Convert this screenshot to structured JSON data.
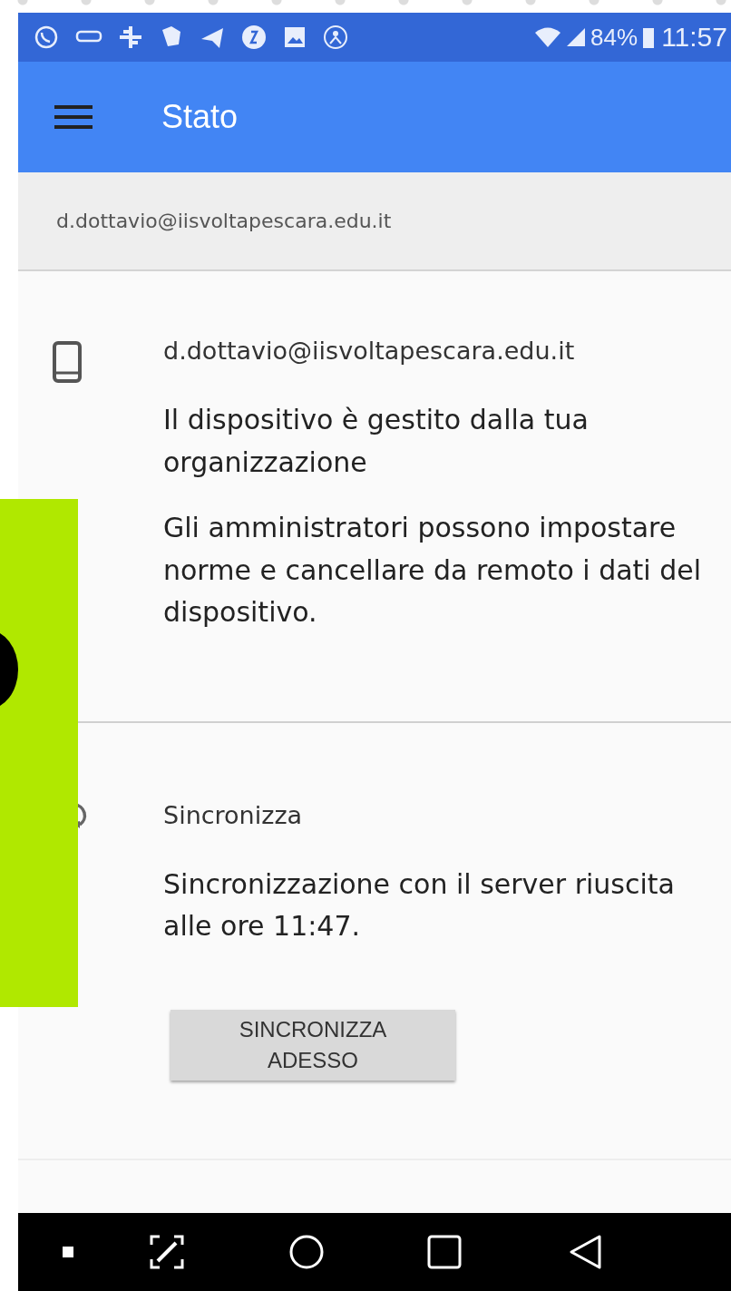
{
  "status_bar": {
    "battery": "84%",
    "time": "11:57"
  },
  "app_bar": {
    "title": "Stato"
  },
  "account_header": {
    "email": "d.dottavio@iisvoltapescara.edu.it"
  },
  "sections": [
    {
      "kind": "device",
      "title": "d.dottavio@iisvoltapescara.edu.it",
      "paragraphs": [
        "Il dispositivo è gestito dalla tua organizzazione",
        "Gli amministratori possono impostare norme e cancellare da remoto i dati del dispositivo."
      ]
    },
    {
      "kind": "sync",
      "title": "Sincronizza",
      "paragraphs": [
        "Sincronizzazione con il server riuscita alle ore 11:47."
      ],
      "button": "SINCRONIZZA\nADESSO"
    }
  ]
}
